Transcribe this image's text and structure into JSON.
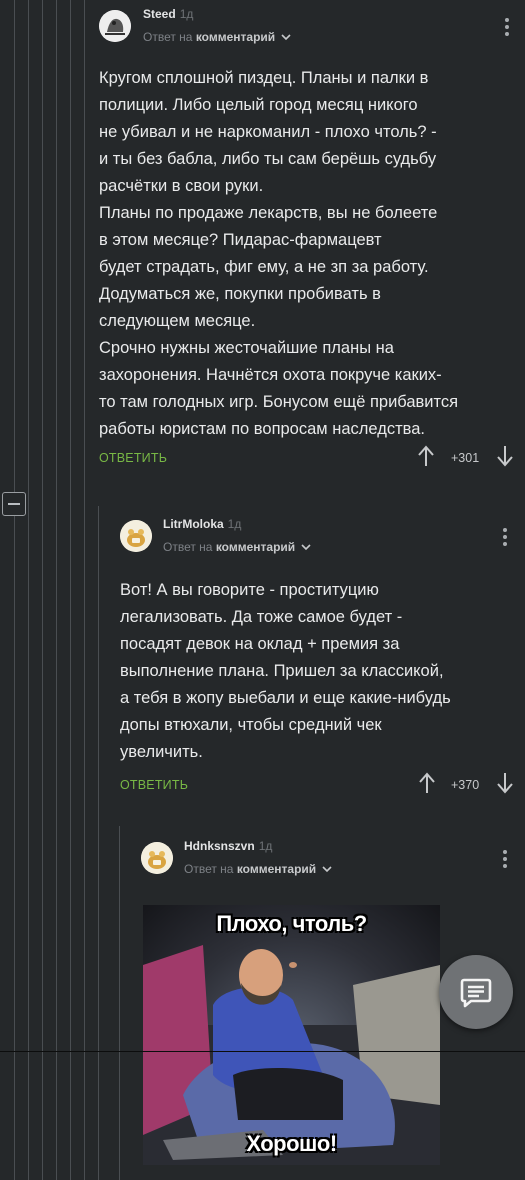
{
  "comments": [
    {
      "username": "Steed",
      "time": "1д",
      "reply_to_prefix": "Ответ на",
      "reply_to_target": "комментарий",
      "lines": [
        "Кругом сплошной пиздец. Планы и палки в",
        "полиции. Либо целый город месяц никого",
        "не убивал и не наркоманил - плохо чтоль? -",
        "и ты без бабла, либо ты сам берёшь судьбу",
        "расчётки в свои руки.",
        "Планы по продаже лекарств, вы не болеете",
        "в этом месяце? Пидарас-фармацевт",
        "будет страдать, фиг ему, а не зп за работу.",
        "Додуматься же, покупки пробивать в",
        "следующем месяце.",
        "Срочно нужны жесточайшие планы на",
        "захоронения. Начнётся охота покруче каких-",
        "то там голодных игр. Бонусом ещё прибавится",
        "работы юристам по вопросам наследства."
      ],
      "reply_label": "ОТВЕТИТЬ",
      "score": "+301"
    },
    {
      "username": "LitrMoloka",
      "time": "1д",
      "reply_to_prefix": "Ответ на",
      "reply_to_target": "комментарий",
      "lines": [
        "Вот! А вы говорите - проституцию",
        "легализовать. Да тоже самое будет -",
        "посадят девок на оклад + премия за",
        "выполнение плана. Пришел за классикой,",
        "а тебя в жопу выебали и еще какие-нибудь",
        "допы втюхали, чтобы средний чек",
        "увеличить."
      ],
      "reply_label": "ОТВЕТИТЬ",
      "score": "+370"
    },
    {
      "username": "Hdnksnszvn",
      "time": "1д",
      "reply_to_prefix": "Ответ на",
      "reply_to_target": "комментарий",
      "image_caption_top": "Плохо, чтоль?",
      "image_caption_bottom": "Хорошо!"
    }
  ],
  "icons": {
    "collapse": "minus-square-icon",
    "fab": "comment-icon",
    "up": "arrow-up-icon",
    "down": "arrow-down-icon",
    "kebab": "kebab-menu-icon"
  },
  "colors": {
    "background": "#25282a",
    "reply_accent": "#78b845",
    "fab": "#6f7275"
  }
}
